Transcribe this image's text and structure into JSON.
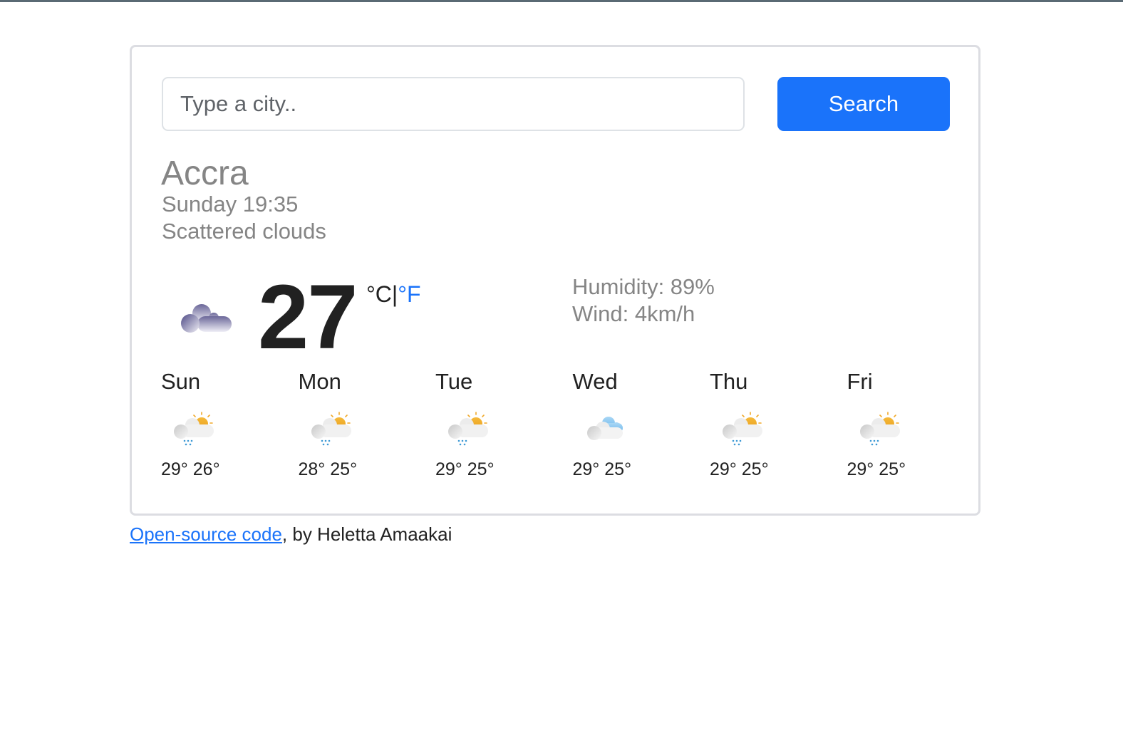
{
  "search": {
    "placeholder": "Type a city..",
    "value": "",
    "button_label": "Search"
  },
  "current": {
    "city": "Accra",
    "date": "Sunday 19:35",
    "description": "Scattered clouds",
    "icon": "scattered-clouds-icon",
    "temperature": "27",
    "unit_celsius": "°C",
    "unit_separator": "|",
    "unit_fahrenheit": "°F",
    "humidity_label": "Humidity: 89%",
    "wind_label": "Wind: 4km/h"
  },
  "forecast": [
    {
      "day": "Sun",
      "icon": "rain-sun-icon",
      "max": "29°",
      "min": "26°"
    },
    {
      "day": "Mon",
      "icon": "rain-sun-icon",
      "max": "28°",
      "min": "25°"
    },
    {
      "day": "Tue",
      "icon": "rain-sun-icon",
      "max": "29°",
      "min": "25°"
    },
    {
      "day": "Wed",
      "icon": "cloudy-icon",
      "max": "29°",
      "min": "25°"
    },
    {
      "day": "Thu",
      "icon": "rain-sun-icon",
      "max": "29°",
      "min": "25°"
    },
    {
      "day": "Fri",
      "icon": "rain-sun-icon",
      "max": "29°",
      "min": "25°"
    }
  ],
  "footer": {
    "link_text": "Open-source code",
    "suffix": ", by Heletta Amaakai"
  },
  "colors": {
    "accent": "#1a73fa",
    "muted_text": "#858585",
    "border": "#dcdde2"
  }
}
